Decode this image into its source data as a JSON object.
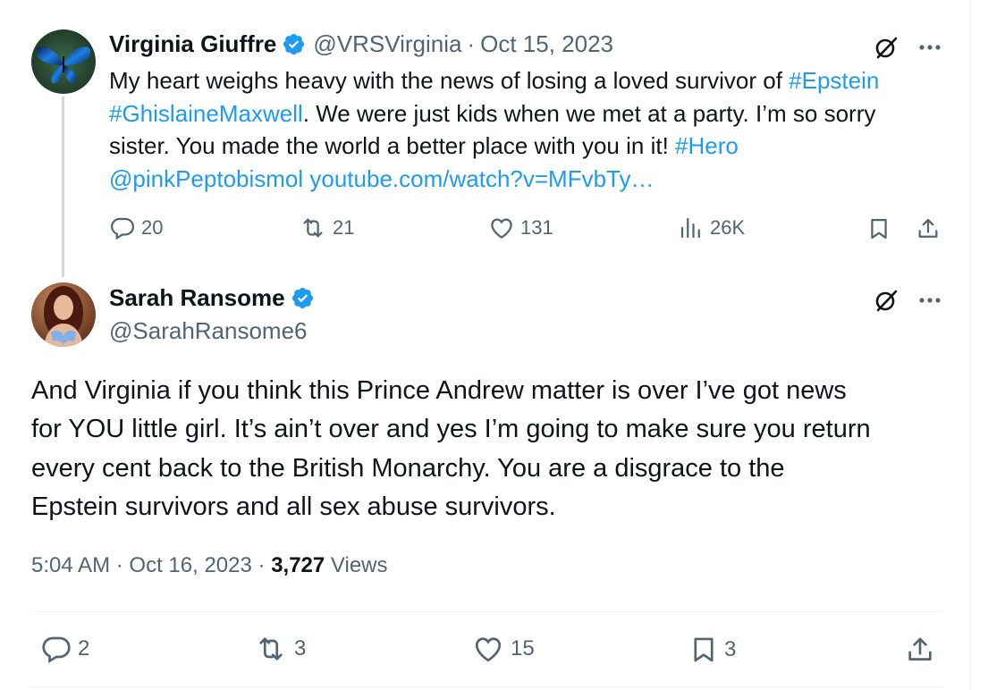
{
  "tweet1": {
    "display_name": "Virginia Giuffre",
    "handle": "@VRSVirginia",
    "separator": "·",
    "date": "Oct 15, 2023",
    "lines": [
      [
        {
          "t": "My heart weighs heavy with the news of losing a loved survivor of ",
          "link": false
        },
        {
          "t": "#Epstein",
          "link": true
        }
      ],
      [
        {
          "t": "#GhislaineMaxwell",
          "link": true
        },
        {
          "t": ". We were just kids when we met at a party. I’m so sorry",
          "link": false
        }
      ],
      [
        {
          "t": "sister. You made the world a better place with you in it! ",
          "link": false
        },
        {
          "t": "#Hero",
          "link": true
        }
      ],
      [
        {
          "t": "@pinkPeptobismol  youtube.com/watch?v=MFvbTy…",
          "link": true
        }
      ]
    ],
    "replies": "20",
    "reposts": "21",
    "likes": "131",
    "views": "26K"
  },
  "tweet2": {
    "display_name": "Sarah Ransome",
    "handle": "@SarahRansome6",
    "text_lines": [
      "And Virginia if you think this Prince Andrew matter is over I’ve got news",
      "for YOU little girl. It’s ain’t over and yes I’m going to make sure you return",
      "every cent back to the British Monarchy. You are a disgrace to the",
      "Epstein survivors and all sex abuse survivors."
    ],
    "time": "5:04 AM",
    "date": "Oct 16, 2023",
    "view_count": "3,727",
    "views_label": "Views",
    "replies": "2",
    "reposts": "3",
    "likes": "15",
    "bookmarks": "3"
  },
  "colors": {
    "accent": "#1d9bf0",
    "secondary_text": "#536471",
    "verified_badge": "#1d9bf0"
  },
  "icons": [
    "verified-badge-icon",
    "grok-icon",
    "more-icon",
    "reply-icon",
    "repost-icon",
    "like-icon",
    "views-icon",
    "bookmark-icon",
    "share-icon"
  ]
}
